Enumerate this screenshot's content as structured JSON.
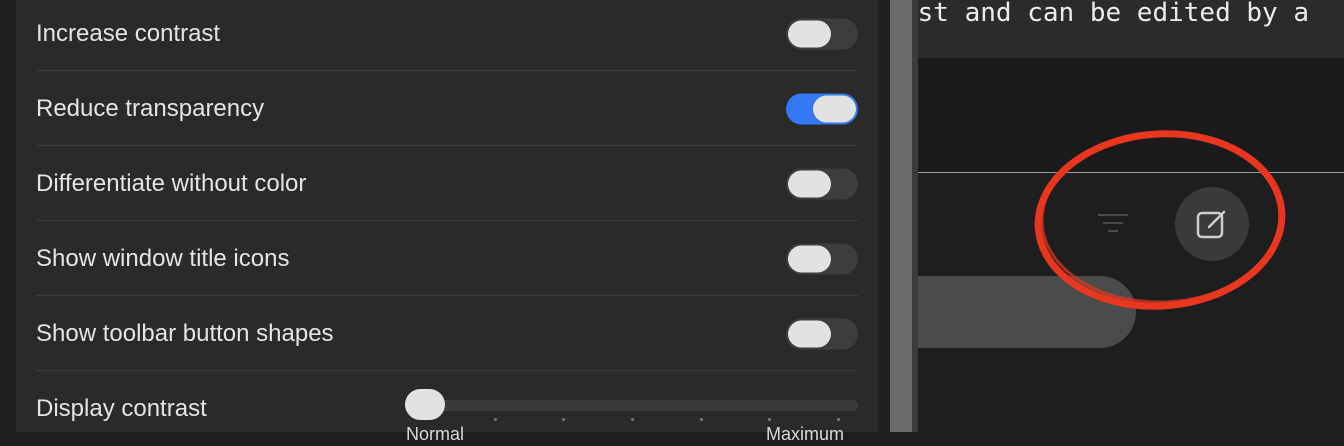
{
  "settings": {
    "rows": [
      {
        "label": "Increase contrast",
        "enabled": false
      },
      {
        "label": "Reduce transparency",
        "enabled": true
      },
      {
        "label": "Differentiate without color",
        "enabled": false
      },
      {
        "label": "Show window title icons",
        "enabled": false
      },
      {
        "label": "Show toolbar button shapes",
        "enabled": false
      }
    ],
    "display_contrast": {
      "label": "Display contrast",
      "value": 0,
      "min_label": "Normal",
      "max_label": "Maximum"
    }
  },
  "app_window": {
    "text_fragment": "ost and can be edited by a",
    "toolbar": {
      "filter_icon": "filter-icon",
      "compose_icon": "compose-icon"
    }
  },
  "colors": {
    "toggle_on": "#3478f6",
    "toggle_off": "#3d3d3d",
    "annotation": "#e8361f"
  }
}
